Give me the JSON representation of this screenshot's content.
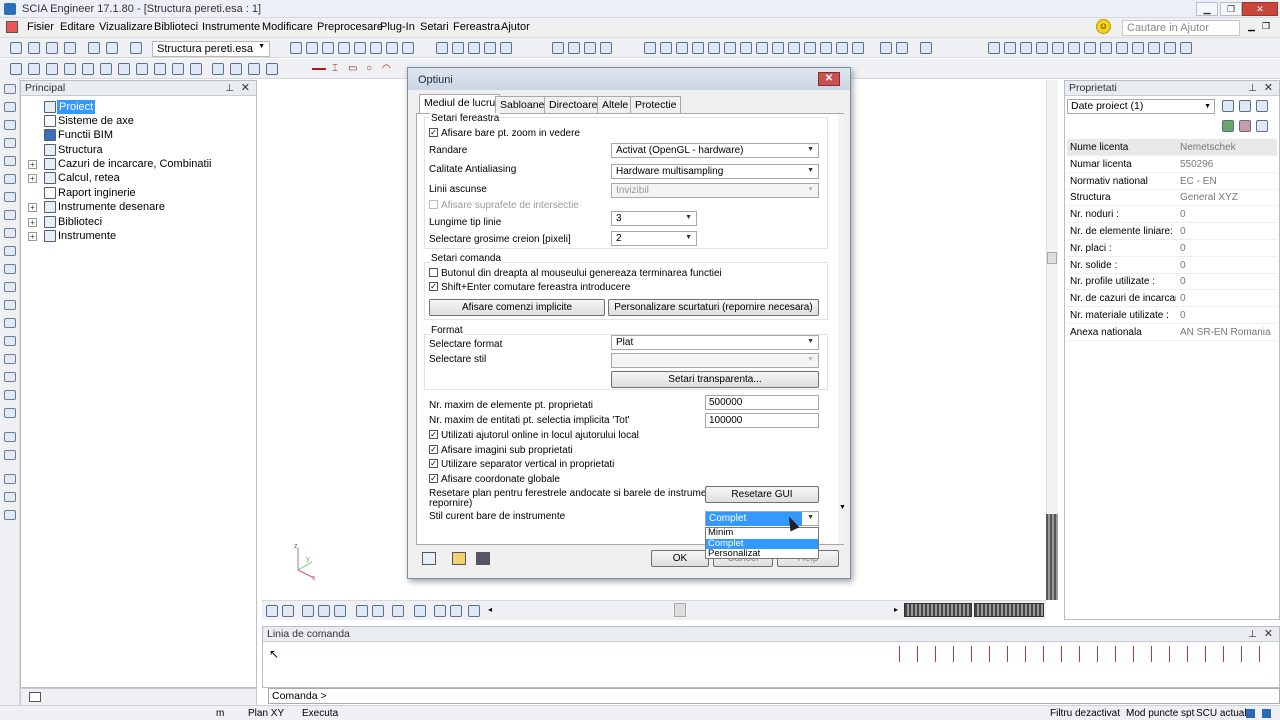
{
  "window": {
    "title": "SCIA Engineer 17.1.80 - [Structura pereti.esa : 1]"
  },
  "menu": [
    "Fisier",
    "Editare",
    "Vizualizare",
    "Biblioteci",
    "Instrumente",
    "Modificare",
    "Preprocesare",
    "Plug-In",
    "Setari",
    "Fereastra",
    "Ajutor"
  ],
  "help_search_placeholder": "Cautare in Ajutor",
  "toolbar": {
    "project_combo": "Structura pereti.esa"
  },
  "principal": {
    "title": "Principal",
    "items": [
      {
        "label": "Proiect",
        "expandable": false,
        "selected": true
      },
      {
        "label": "Sisteme de axe",
        "expandable": false
      },
      {
        "label": "Functii BIM",
        "expandable": false
      },
      {
        "label": "Structura",
        "expandable": false
      },
      {
        "label": "Cazuri de incarcare, Combinatii",
        "expandable": true
      },
      {
        "label": "Calcul, retea",
        "expandable": true
      },
      {
        "label": "Raport inginerie",
        "expandable": false
      },
      {
        "label": "Instrumente desenare",
        "expandable": true
      },
      {
        "label": "Biblioteci",
        "expandable": true
      },
      {
        "label": "Instrumente",
        "expandable": true
      }
    ]
  },
  "properties": {
    "title": "Proprietati",
    "combo": "Date proiect (1)",
    "rows": [
      {
        "key": "Nume licenta",
        "value": "Nemetschek"
      },
      {
        "key": "Numar licenta",
        "value": "550296"
      },
      {
        "key": "Normativ national",
        "value": "EC - EN"
      },
      {
        "key": "Structura",
        "value": "General XYZ"
      },
      {
        "key": "Nr. noduri :",
        "value": "0"
      },
      {
        "key": "Nr. de elemente liniare:",
        "value": "0"
      },
      {
        "key": "Nr. placi :",
        "value": "0"
      },
      {
        "key": "Nr. solide :",
        "value": "0"
      },
      {
        "key": "Nr. profile utilizate :",
        "value": "0"
      },
      {
        "key": "Nr. de cazuri de incarcare :",
        "value": "0"
      },
      {
        "key": "Nr. materiale utilizate :",
        "value": "0"
      },
      {
        "key": "Anexa nationala",
        "value": "AN SR-EN Romania"
      }
    ]
  },
  "command": {
    "title": "Linia de comanda",
    "prompt": "Comanda >"
  },
  "status": {
    "cells": [
      "m",
      "Plan XY",
      "Executa",
      "Filtru dezactivat",
      "Mod puncte spt",
      "SCU actual"
    ]
  },
  "dialog": {
    "title": "Optiuni",
    "tabs": [
      "Mediul de lucru",
      "Sabloane",
      "Directoare",
      "Altele",
      "Protectie"
    ],
    "window_settings": {
      "group": "Setari fereastra",
      "zoom_checkbox": "Afisare bare pt. zoom in vedere",
      "render_label": "Randare",
      "render_value": "Activat (OpenGL - hardware)",
      "aa_label": "Calitate Antialiasing",
      "aa_value": "Hardware multisampling",
      "hidden_label": "Linii ascunse",
      "hidden_value": "Invizibil",
      "intersect_checkbox": "Afisare suprafete de intersectie",
      "linetype_label": "Lungime tip linie",
      "linetype_value": "3",
      "pen_label": "Selectare grosime creion [pixeli]",
      "pen_value": "2"
    },
    "command_settings": {
      "group": "Setari comanda",
      "rightclick_checkbox": "Butonul din dreapta al mouseului genereaza terminarea functiei",
      "shiftenter_checkbox": "Shift+Enter comutare fereastra introducere",
      "implicit_btn": "Afisare comenzi implicite",
      "shortcut_btn": "Personalizare scurtaturi (repornire necesara)"
    },
    "format": {
      "group": "Format",
      "format_label": "Selectare format",
      "format_value": "Plat",
      "style_label": "Selectare stil",
      "style_value": "",
      "transparency_btn": "Setari transparenta..."
    },
    "max_props_label": "Nr. maxim de elemente pt. proprietati",
    "max_props_value": "500000",
    "max_entities_label": "Nr. maxim de entitati pt. selectia implicita 'Tot'",
    "max_entities_value": "100000",
    "help_checkbox": "Utilizati ajutorul online in locul ajutorului local",
    "images_checkbox": "Afisare imagini sub proprietati",
    "separator_checkbox": "Utilizare separator vertical in proprietati",
    "coords_checkbox": "Afisare coordonate globale",
    "reset_label_1": "Resetare plan pentru ferestrele andocate si barele de instrumente (dupa",
    "reset_label_2": "repornire)",
    "reset_btn": "Resetare GUI",
    "toolbar_style_label": "Stil curent bare de instrumente",
    "toolbar_style_value": "Complet",
    "toolbar_style_options": [
      "Minim",
      "Complet",
      "Personalizat"
    ],
    "ok_btn": "OK",
    "cancel_btn": "Cancel",
    "help_btn": "Help"
  }
}
